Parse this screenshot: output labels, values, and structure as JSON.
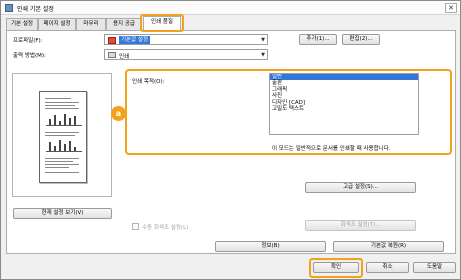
{
  "window": {
    "title": "인쇄 기본 설정",
    "close_glyph": "✕"
  },
  "tabs": [
    {
      "label": "기본 설정",
      "active": false
    },
    {
      "label": "페이지 설정",
      "active": false
    },
    {
      "label": "마무리",
      "active": false
    },
    {
      "label": "용지 공급",
      "active": false
    },
    {
      "label": "인쇄 품질",
      "active": true
    }
  ],
  "profile": {
    "label": "프로파일(F):",
    "value": "기본값 설정",
    "add_button": "추가(1)...",
    "edit_button": "편집(2)..."
  },
  "output": {
    "label": "출력 방법(M):",
    "value": "인쇄"
  },
  "quality": {
    "label": "인쇄 목적(O):",
    "items": [
      "일반",
      "출판",
      "그래픽",
      "사진",
      "디자인 [CAD]",
      "고밀도 텍스트"
    ],
    "selected_index": 0,
    "description": "이 모드는 일반적으로 문서를 인쇄할 때 사용합니다.",
    "badge": "a"
  },
  "advanced_button": "고급 설정(S)...",
  "view_settings_button": "현재 설정 보기(V)",
  "manual_checkbox_label": "수동 회색조 설정(L)",
  "grayscale_button": "회색조 설정(T)...",
  "info_button": "정보(B)",
  "restore_button": "기본값 복원(R)",
  "footer": {
    "ok": "확인",
    "cancel": "취소",
    "help": "도움말"
  },
  "colors": {
    "highlight": "#f3a21c",
    "selection": "#3377d9"
  },
  "icons": {
    "app": "printer-settings-icon",
    "profile": "profile-icon",
    "output": "printer-icon",
    "close": "close-icon"
  }
}
